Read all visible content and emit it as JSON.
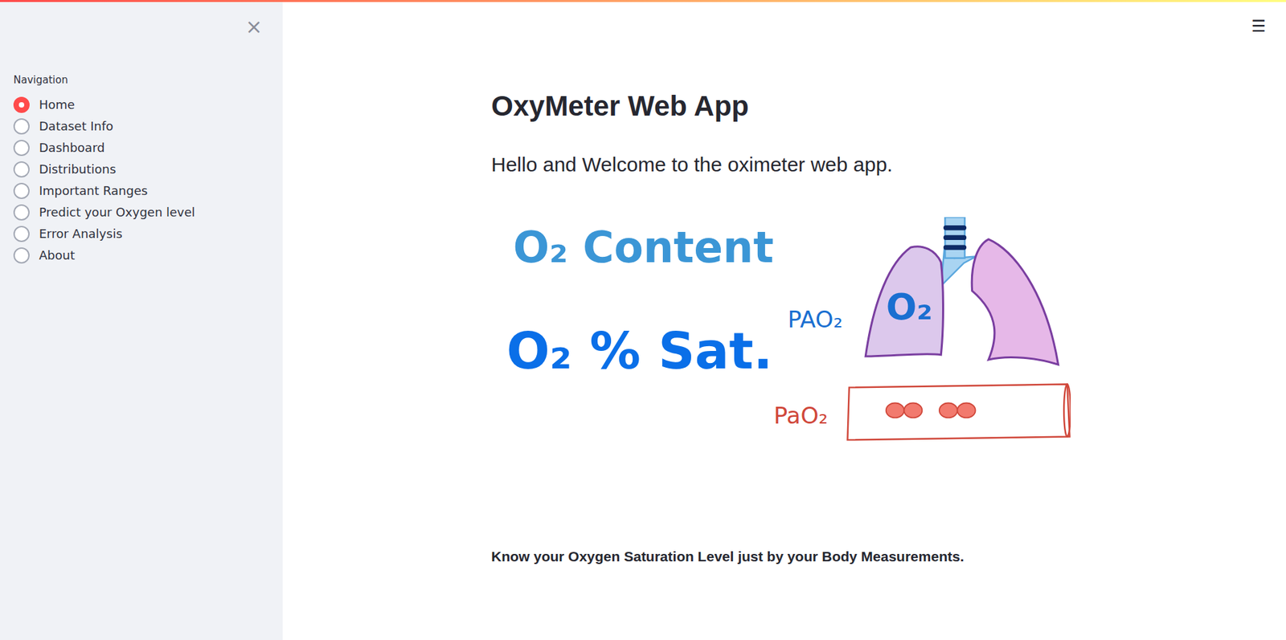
{
  "sidebar": {
    "close": "×",
    "label": "Navigation",
    "items": [
      {
        "label": "Home",
        "selected": true
      },
      {
        "label": "Dataset Info",
        "selected": false
      },
      {
        "label": "Dashboard",
        "selected": false
      },
      {
        "label": "Distributions",
        "selected": false
      },
      {
        "label": "Important Ranges",
        "selected": false
      },
      {
        "label": "Predict your Oxygen level",
        "selected": false
      },
      {
        "label": "Error Analysis",
        "selected": false
      },
      {
        "label": "About",
        "selected": false
      }
    ]
  },
  "menu": "☰",
  "main": {
    "title": "OxyMeter Web App",
    "subtitle": "Hello and Welcome to the oximeter web app.",
    "tagline": "Know your Oxygen Saturation Level just by your Body Measurements."
  },
  "illustration": {
    "content": "O₂ Content",
    "saturation": "O₂ % Sat.",
    "alveolar": "PAO₂",
    "arterial": "PaO₂",
    "lung": "O₂"
  }
}
